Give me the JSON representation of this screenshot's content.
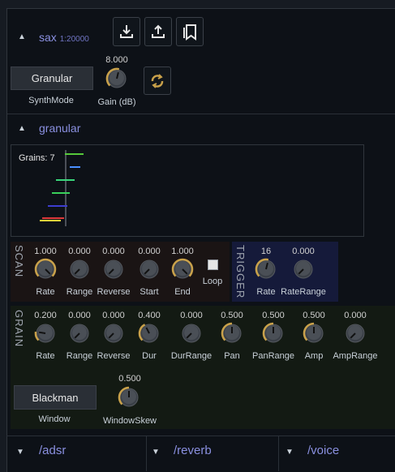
{
  "section_sax": {
    "title": "sax",
    "subtitle": "1:20000"
  },
  "toolbar": {
    "download_icon": "download-icon",
    "upload_icon": "upload-icon",
    "presets_icon": "bookmarks-icon"
  },
  "synthmode": {
    "button": "Granular",
    "label": "SynthMode"
  },
  "gain": {
    "value": "8.000",
    "label": "Gain (dB)",
    "level": 0.55
  },
  "refresh_icon": "refresh-icon",
  "section_granular": {
    "title": "granular"
  },
  "grains_display": {
    "label": "Grains: 7"
  },
  "scan": {
    "title": "SCAN",
    "knobs": [
      {
        "label": "Rate",
        "value": "1.000"
      },
      {
        "label": "Range",
        "value": "0.000"
      },
      {
        "label": "Reverse",
        "value": "0.000"
      },
      {
        "label": "Start",
        "value": "0.000"
      },
      {
        "label": "End",
        "value": "1.000"
      }
    ],
    "loop_label": "Loop"
  },
  "trigger": {
    "title": "TRIGGER",
    "knobs": [
      {
        "label": "Rate",
        "value": "16"
      },
      {
        "label": "RateRange",
        "value": "0.000"
      }
    ]
  },
  "grain": {
    "title": "GRAIN",
    "knobs": [
      {
        "label": "Rate",
        "value": "0.200"
      },
      {
        "label": "Range",
        "value": "0.000"
      },
      {
        "label": "Reverse",
        "value": "0.000"
      },
      {
        "label": "Dur",
        "value": "0.400"
      },
      {
        "label": "DurRange",
        "value": "0.000"
      },
      {
        "label": "Pan",
        "value": "0.500"
      },
      {
        "label": "PanRange",
        "value": "0.500"
      },
      {
        "label": "Amp",
        "value": "0.500"
      },
      {
        "label": "AmpRange",
        "value": "0.000"
      }
    ]
  },
  "window": {
    "button": "Blackman",
    "label": "Window"
  },
  "windowskew": {
    "value": "0.500",
    "label": "WindowSkew"
  },
  "collapsed_sections": [
    {
      "title": "/adsr"
    },
    {
      "title": "/reverb"
    },
    {
      "title": "/voice"
    }
  ],
  "colors": {
    "accent": "#8a90e0",
    "knob_arc": "#c9a14a",
    "scan_bg": "#1a1414",
    "trigger_bg": "#151a3a",
    "grain_bg": "#131a13"
  }
}
